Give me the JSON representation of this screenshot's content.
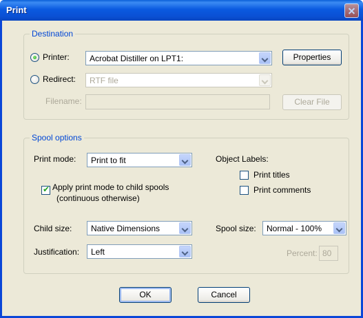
{
  "window": {
    "title": "Print"
  },
  "destination": {
    "legend": "Destination",
    "printer_label": "Printer:",
    "printer_value": "Acrobat Distiller on LPT1:",
    "properties_button": "Properties",
    "redirect_label": "Redirect:",
    "redirect_value": "RTF file",
    "filename_label": "Filename:",
    "filename_value": "",
    "clear_file_button": "Clear File",
    "selected": "printer"
  },
  "spool_options": {
    "legend": "Spool options",
    "print_mode_label": "Print mode:",
    "print_mode_value": "Print to fit",
    "apply_child_label_line1": "Apply print mode to child spools",
    "apply_child_label_line2": "(continuous otherwise)",
    "apply_child_checked": true,
    "object_labels_label": "Object Labels:",
    "print_titles_label": "Print titles",
    "print_titles_checked": false,
    "print_comments_label": "Print comments",
    "print_comments_checked": false,
    "child_size_label": "Child size:",
    "child_size_value": "Native Dimensions",
    "spool_size_label": "Spool size:",
    "spool_size_value": "Normal - 100%",
    "justification_label": "Justification:",
    "justification_value": "Left",
    "percent_label": "Percent:",
    "percent_value": "80"
  },
  "buttons": {
    "ok": "OK",
    "cancel": "Cancel"
  },
  "colors": {
    "titlebar": "#0a50d4",
    "dialog_bg": "#ece9d8",
    "group_legend": "#0046d5"
  }
}
